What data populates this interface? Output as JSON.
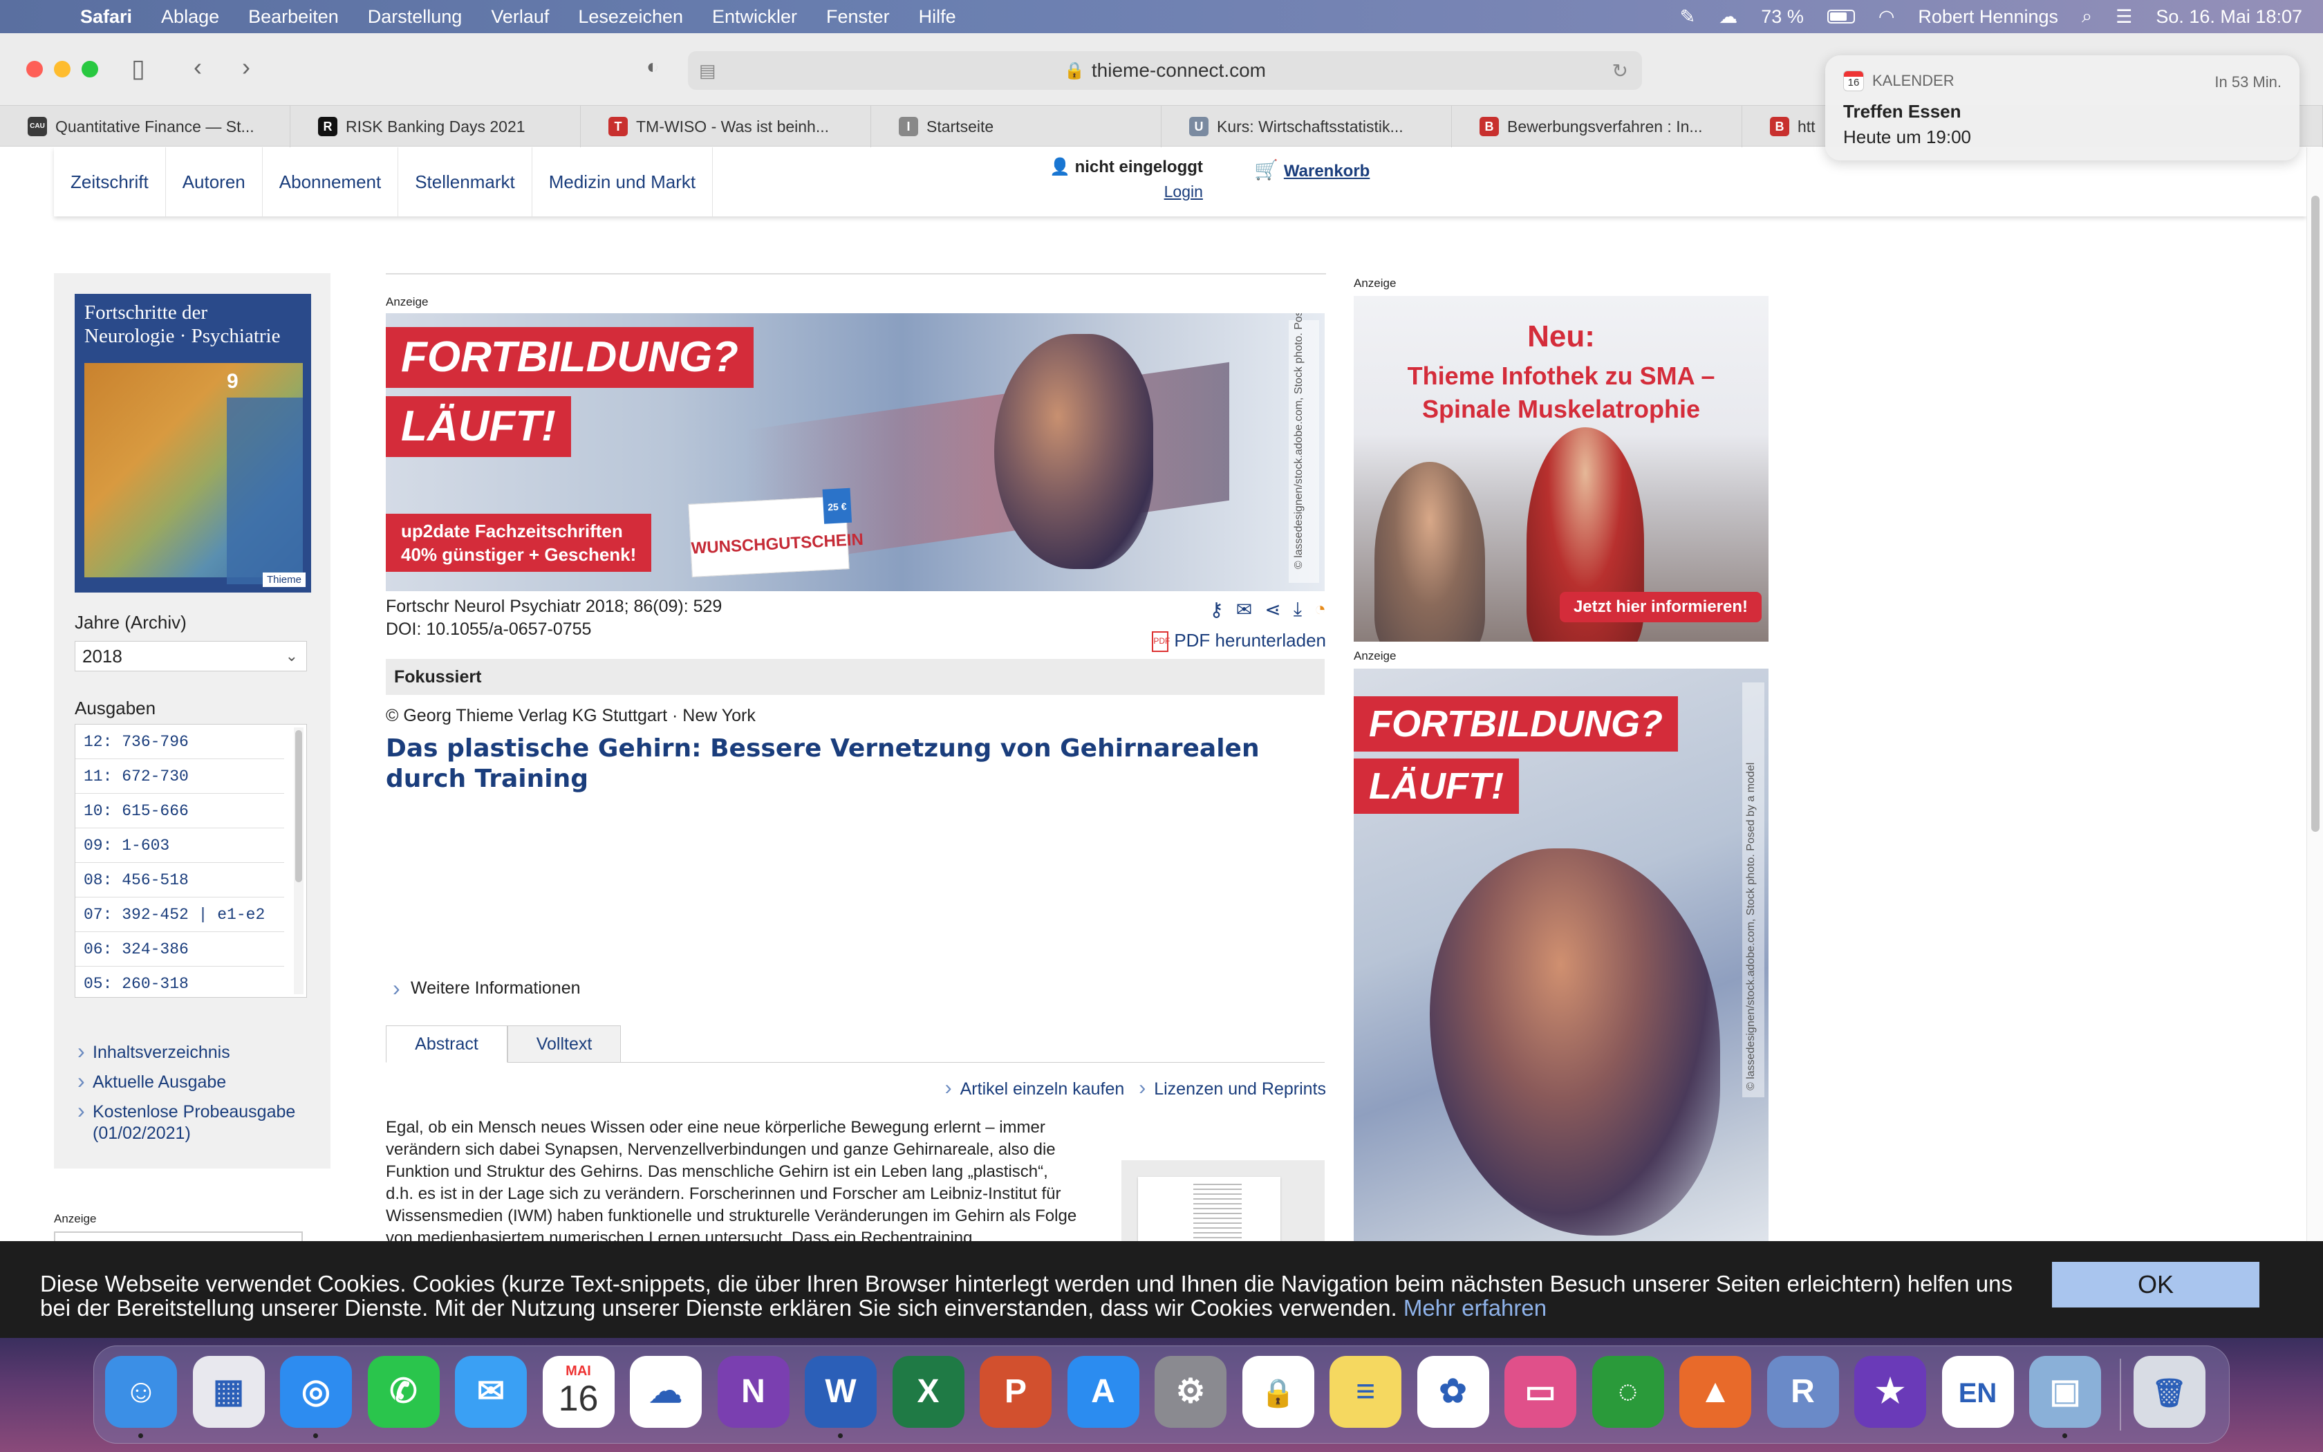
{
  "menubar": {
    "app": "Safari",
    "items": [
      "Ablage",
      "Bearbeiten",
      "Darstellung",
      "Verlauf",
      "Lesezeichen",
      "Entwickler",
      "Fenster",
      "Hilfe"
    ],
    "battery": "73 %",
    "user": "Robert Hennings",
    "datetime": "So. 16. Mai  18:07"
  },
  "browser": {
    "url": "thieme-connect.com",
    "tabs": [
      {
        "label": "Quantitative Finance — St...",
        "color": "#3a3a3a",
        "glyph": "CAU"
      },
      {
        "label": "RISK Banking Days 2021",
        "color": "#111111",
        "glyph": "R"
      },
      {
        "label": "TM-WISO - Was ist beinh...",
        "color": "#c8302e",
        "glyph": "T"
      },
      {
        "label": "Startseite",
        "color": "#888888",
        "glyph": "I"
      },
      {
        "label": "Kurs: Wirtschaftsstatistik...",
        "color": "#7a8aa0",
        "glyph": "U"
      },
      {
        "label": "Bewerbungsverfahren : In...",
        "color": "#c8302e",
        "glyph": "B"
      },
      {
        "label": "htt",
        "color": "#c8302e",
        "glyph": "B"
      }
    ]
  },
  "notification": {
    "app": "KALENDER",
    "day": "16",
    "time": "In 53 Min.",
    "title": "Treffen Essen",
    "subtitle": "Heute um 19:00"
  },
  "site": {
    "nav": [
      "Zeitschrift",
      "Autoren",
      "Abonnement",
      "Stellenmarkt",
      "Medizin und Markt"
    ],
    "login_status": "nicht eingeloggt",
    "login_link": "Login",
    "cart": "Warenkorb"
  },
  "sidebar": {
    "journal_title": "Fortschritte der Neurologie · Psychiatrie",
    "cover_issue": "9",
    "cover_publisher": "Thieme",
    "years_label": "Jahre (Archiv)",
    "year_selected": "2018",
    "issues_label": "Ausgaben",
    "issues": [
      "12: 736-796",
      "11: 672-730",
      "10: 615-666",
      "09: 1-603",
      "08: 456-518",
      "07: 392-452 | e1-e2",
      "06: 324-386",
      "05: 260-318"
    ],
    "links": [
      "Inhaltsverzeichnis",
      "Aktuelle Ausgabe",
      "Kostenlose Probeausgabe (01/02/2021)"
    ],
    "ad_label": "Anzeige"
  },
  "banner": {
    "label": "Anzeige",
    "line1": "FORTBILDUNG?",
    "line2": "LÄUFT!",
    "line3a": "up2date Fachzeitschriften",
    "line3b": "40% günstiger + Geschenk!",
    "gift": "WUNSCHGUTSCHEIN",
    "gift_value": "25 €",
    "credit": "© lassedesignen/stock.adobe.com, Stock photo. Posed by a model"
  },
  "article": {
    "citation": "Fortschr Neurol Psychiatr 2018; 86(09): 529",
    "doi": "DOI: 10.1055/a-0657-0755",
    "pdf_link": "PDF herunterladen",
    "section": "Fokussiert",
    "copyright": "© Georg Thieme Verlag KG Stuttgart · New York",
    "title": "Das plastische Gehirn: Bessere Vernetzung von Gehirnarealen durch Training",
    "more_info": "Weitere Informationen",
    "tab_abstract": "Abstract",
    "tab_fulltext": "Volltext",
    "buy": "Artikel einzeln kaufen",
    "licenses": "Lizenzen und Reprints",
    "abstract": "Egal, ob ein Mensch neues Wissen oder eine neue körperliche Bewegung erlernt – immer verändern sich dabei Synapsen, Nervenzellverbindungen und ganze Gehirnareale, also die Funktion und Struktur des Gehirns. Das menschliche Gehirn ist ein Leben lang „plastisch“, d.h. es ist in der Lage sich zu verändern. Forscherinnen und Forscher am Leibniz-Institut für Wissensmedien (IWM) haben funktionelle und strukturelle Veränderungen im Gehirn als Folge von medienbasiertem numerischen Lernen untersucht. Dass ein Rechentraining Auswirkungen auf unsere Rechenfähigkeit hat, scheint aus dem Bauch heraus klar. Das zeigte sich in der Studie auch auf neuronaler Ebene: Durch das Training veränderte sich das Netzwerk aus Gehirnarealen, das zur Lösung einer Aufgabe aktiviert wurde. In der Studie am IWM sind jetzt aber auch strukturelle Veränderungen im Gehirn durch das Rechentraining deutlich geworden – und somit"
  },
  "right_ads": {
    "label1": "Anzeige",
    "ad1_title": "Neu:",
    "ad1_sub1": "Thieme Infothek zu SMA –",
    "ad1_sub2": "Spinale Muskelatrophie",
    "ad1_cta": "Jetzt hier informieren!",
    "label2": "Anzeige",
    "ad2_line1": "FORTBILDUNG?",
    "ad2_line2": "LÄUFT!",
    "ad2_credit": "© lassedesignen/stock.adobe.com, Stock photo. Posed by a model"
  },
  "cookie": {
    "text": "Diese Webseite verwendet Cookies. Cookies (kurze Text-snippets, die über Ihren Browser hinterlegt werden und Ihnen die Navigation beim nächsten Besuch unserer Seiten erleichtern) helfen uns bei der Bereitstellung unserer Dienste. Mit der Nutzung unserer Dienste erklären Sie sich einverstanden, dass wir Cookies verwenden.",
    "more": "Mehr erfahren",
    "ok": "OK"
  },
  "dock": {
    "calendar_month": "MAI",
    "calendar_day": "16",
    "apps": [
      {
        "name": "finder-icon",
        "bg": "#3b8fe6",
        "glyph": "☺",
        "dot": true
      },
      {
        "name": "launchpad-icon",
        "bg": "#e8e8ee",
        "glyph": "▦",
        "dot": false
      },
      {
        "name": "safari-icon",
        "bg": "#2d8cf0",
        "glyph": "◎",
        "dot": true
      },
      {
        "name": "whatsapp-icon",
        "bg": "#2ac54c",
        "glyph": "✆",
        "dot": false
      },
      {
        "name": "mail-icon",
        "bg": "#3aa0f4",
        "glyph": "✉",
        "dot": false
      },
      {
        "name": "calendar-icon",
        "bg": "#ffffff",
        "glyph": "",
        "dot": false
      },
      {
        "name": "onedrive-icon",
        "bg": "#ffffff",
        "glyph": "☁",
        "dot": false
      },
      {
        "name": "onenote-icon",
        "bg": "#7a3fb0",
        "glyph": "N",
        "dot": false
      },
      {
        "name": "word-icon",
        "bg": "#2b5fb8",
        "glyph": "W",
        "dot": true
      },
      {
        "name": "excel-icon",
        "bg": "#1f7a45",
        "glyph": "X",
        "dot": false
      },
      {
        "name": "powerpoint-icon",
        "bg": "#d2502e",
        "glyph": "P",
        "dot": false
      },
      {
        "name": "app-store-icon",
        "bg": "#2b8cf0",
        "glyph": "A",
        "dot": false
      },
      {
        "name": "system-preferences-icon",
        "bg": "#8a8a90",
        "glyph": "⚙",
        "dot": false
      },
      {
        "name": "lock-icon",
        "bg": "#ffffff",
        "glyph": "🔒",
        "dot": false
      },
      {
        "name": "notes-icon",
        "bg": "#f5d860",
        "glyph": "≡",
        "dot": false
      },
      {
        "name": "photos-icon",
        "bg": "#ffffff",
        "glyph": "✿",
        "dot": false
      },
      {
        "name": "presentation-icon",
        "bg": "#e0508a",
        "glyph": "▭",
        "dot": false
      },
      {
        "name": "circle-app-icon",
        "bg": "#2a9a3a",
        "glyph": "◌",
        "dot": false
      },
      {
        "name": "matlab-icon",
        "bg": "#e86a2a",
        "glyph": "▲",
        "dot": false
      },
      {
        "name": "r-icon",
        "bg": "#6a8ac8",
        "glyph": "R",
        "dot": false
      },
      {
        "name": "imovie-icon",
        "bg": "#6a3ab8",
        "glyph": "★",
        "dot": false
      },
      {
        "name": "dictionary-icon",
        "bg": "#ffffff",
        "glyph": "EN",
        "dot": false
      },
      {
        "name": "preview-icon",
        "bg": "#8ab0d8",
        "glyph": "▣",
        "dot": true
      },
      {
        "name": "trash-icon",
        "bg": "#d8dce4",
        "glyph": "🗑",
        "dot": false
      }
    ]
  }
}
